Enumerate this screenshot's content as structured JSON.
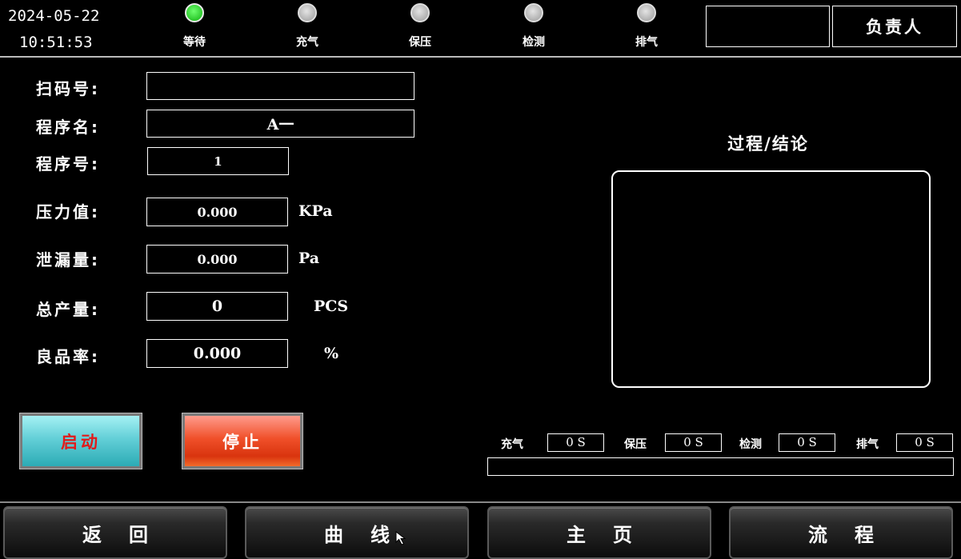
{
  "header": {
    "date": "2024-05-22",
    "time": "10:51:53",
    "stages": [
      {
        "label": "等待",
        "status": "active",
        "color": "#22cc22"
      },
      {
        "label": "充气",
        "status": "inactive",
        "color": "#bcbcbc"
      },
      {
        "label": "保压",
        "status": "inactive",
        "color": "#bcbcbc"
      },
      {
        "label": "检测",
        "status": "inactive",
        "color": "#bcbcbc"
      },
      {
        "label": "排气",
        "status": "inactive",
        "color": "#bcbcbc"
      }
    ],
    "operator_value": "",
    "operator_label": "负责人"
  },
  "form": {
    "scan_code": {
      "label": "扫码号:",
      "value": ""
    },
    "program_name": {
      "label": "程序名:",
      "value": "A一"
    },
    "program_no": {
      "label": "程序号:",
      "value": "1"
    },
    "pressure": {
      "label": "压力值:",
      "value": "0.000",
      "unit": "KPa"
    },
    "leakage": {
      "label": "泄漏量:",
      "value": "0.000",
      "unit": "Pa"
    },
    "total_output": {
      "label": "总产量:",
      "value": "0",
      "unit": "PCS"
    },
    "yield_rate": {
      "label": "良品率:",
      "value": "0.000",
      "unit": "%"
    }
  },
  "process": {
    "title": "过程/结论",
    "content": ""
  },
  "controls": {
    "start_label": "启动",
    "stop_label": "停止"
  },
  "timers": [
    {
      "label": "充气",
      "value": "0 S"
    },
    {
      "label": "保压",
      "value": "0 S"
    },
    {
      "label": "检测",
      "value": "0 S"
    },
    {
      "label": "排气",
      "value": "0 S"
    }
  ],
  "progress": {
    "value": 0
  },
  "nav": {
    "back": "返回",
    "curve": "曲线",
    "home": "主页",
    "flow": "流程"
  },
  "colors": {
    "background": "#000000",
    "start_button": "#4fc6cf",
    "stop_button": "#e8441e",
    "start_text": "#e21a1a"
  }
}
